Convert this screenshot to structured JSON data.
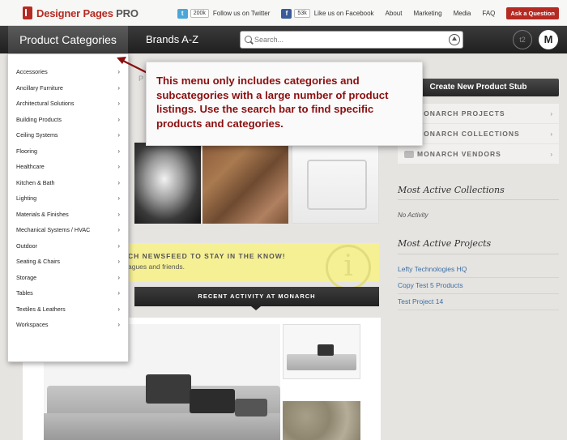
{
  "topbar": {
    "logo_main": "Designer Pages",
    "logo_suffix": "PRO",
    "twitter_count": "200k",
    "twitter_label": "Follow us on Twitter",
    "facebook_count": "53k",
    "facebook_label": "Like us on Facebook",
    "links": [
      "About",
      "Marketing",
      "Media",
      "FAQ"
    ],
    "ask_button": "Ask a Question"
  },
  "nav": {
    "categories_label": "Product Categories",
    "brands_label": "Brands A-Z",
    "search_placeholder": "Search...",
    "circle_label": "t2",
    "avatar_letter": "M"
  },
  "dropdown": {
    "items": [
      "Accessories",
      "Ancillary Furniture",
      "Architectural Solutions",
      "Building Products",
      "Ceiling Systems",
      "Flooring",
      "Healthcare",
      "Kitchen & Bath",
      "Lighting",
      "Materials & Finishes",
      "Mechanical Systems / HVAC",
      "Outdoor",
      "Seating & Chairs",
      "Storage",
      "Tables",
      "Textiles & Leathers",
      "Workspaces"
    ],
    "arrow": "›"
  },
  "callout": {
    "text": "This menu only includes categories and subcategories with a large number of product listings. Use the search bar to find specific products and categories."
  },
  "main": {
    "ghost_letter": "P",
    "newsfeed_title": "CH NEWSFEED TO STAY IN THE KNOW!",
    "newsfeed_sub": "agues and friends.",
    "recent_activity": "RECENT ACTIVITY AT MONARCH"
  },
  "sidebar": {
    "create_button": "Create New Product Stub",
    "links": [
      "MONARCH PROJECTS",
      "MONARCH COLLECTIONS",
      "MONARCH VENDORS"
    ],
    "arrow": "›",
    "collections_heading": "Most Active Collections",
    "collections_empty": "No Activity",
    "projects_heading": "Most Active Projects",
    "projects": [
      "Lefty Technologies HQ",
      "Copy Test 5 Products",
      "Test Project 14"
    ]
  },
  "colors": {
    "brand_red": "#b52a22",
    "annotation_red": "#8b0f10",
    "link_blue": "#3a6ea5",
    "newsfeed_yellow": "#f6f094"
  }
}
